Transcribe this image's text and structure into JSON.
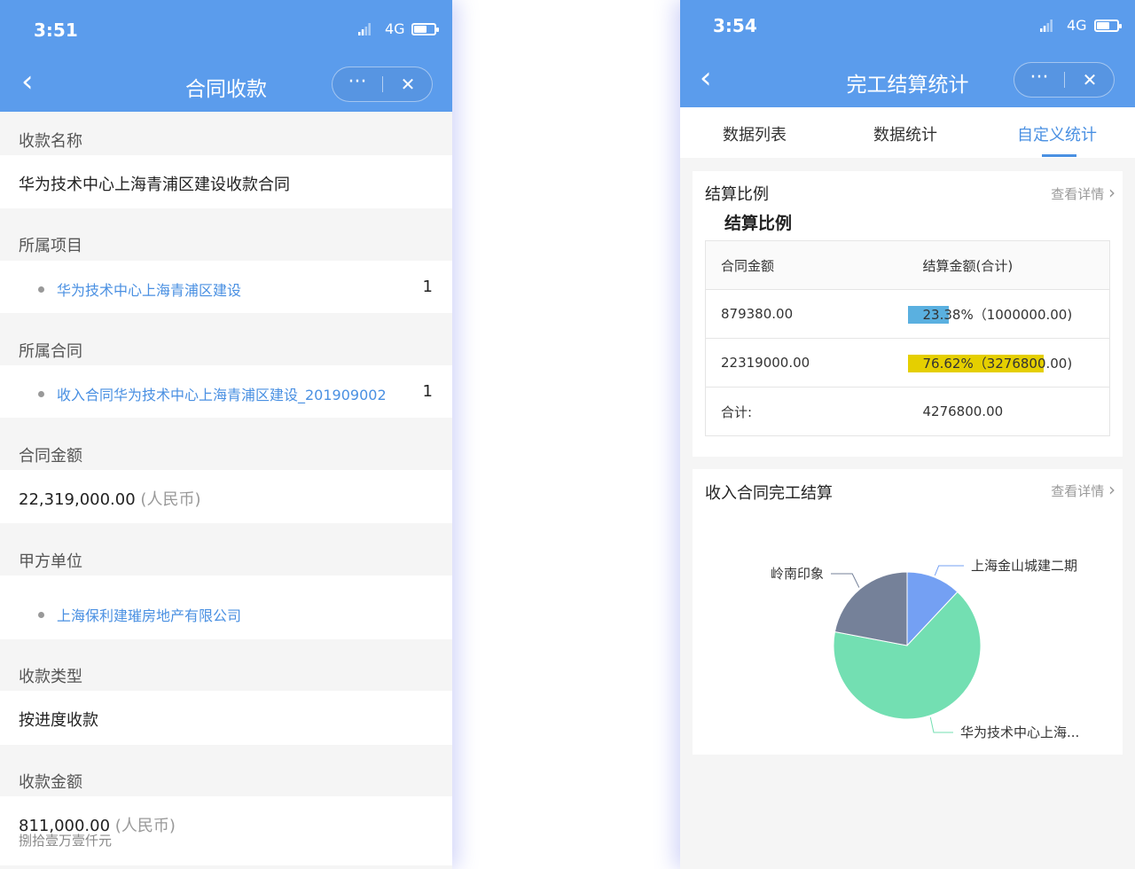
{
  "left": {
    "status": {
      "time": "3:51",
      "network": "4G"
    },
    "nav": {
      "title": "合同收款",
      "back": "‹",
      "more": "···",
      "close": "✕"
    },
    "fields": [
      {
        "label": "收款名称",
        "value": "华为技术中心上海青浦区建设收款合同"
      },
      {
        "label": "所属项目",
        "link": "华为技术中心上海青浦区建设",
        "count": "1"
      },
      {
        "label": "所属合同",
        "link": "收入合同华为技术中心上海青浦区建设_201909002",
        "count": "1"
      },
      {
        "label": "合同金额",
        "value": "22,319,000.00",
        "unit": "(人民币)"
      },
      {
        "label": "甲方单位",
        "link": "上海保利建璀房地产有限公司"
      },
      {
        "label": "收款类型",
        "value": "按进度收款"
      },
      {
        "label": "收款金额",
        "value": "811,000.00",
        "unit": "(人民币)",
        "sub": "捌拾壹万壹仟元"
      }
    ]
  },
  "right": {
    "status": {
      "time": "3:54",
      "network": "4G"
    },
    "nav": {
      "title": "完工结算统计",
      "back": "‹",
      "more": "···",
      "close": "✕"
    },
    "tabs": [
      {
        "label": "数据列表",
        "active": false
      },
      {
        "label": "数据统计",
        "active": false
      },
      {
        "label": "自定义统计",
        "active": true
      }
    ],
    "card1": {
      "title": "结算比例",
      "link": "查看详情",
      "chevron": "›",
      "subtitle": "结算比例",
      "headers": [
        "合同金额",
        "结算金额(合计)"
      ],
      "rows": [
        {
          "amount": "879380.00",
          "ratio": "23.38%（1000000.00)",
          "percent": 23.38,
          "color": "#5ab0e0"
        },
        {
          "amount": "22319000.00",
          "ratio": "76.62%（3276800.00)",
          "percent": 76.62,
          "color": "#e5cf00"
        }
      ],
      "total": {
        "label": "合计:",
        "value": "4276800.00"
      }
    },
    "card2": {
      "title": "收入合同完工结算",
      "link": "查看详情",
      "chevron": "›"
    },
    "chart_data": {
      "type": "pie",
      "labels": [
        "上海金山城建二期",
        "华为技术中心上海...",
        "岭南印象"
      ],
      "values": [
        12,
        66,
        22
      ],
      "colors": [
        "#74a0f3",
        "#73dfb2",
        "#758199"
      ],
      "legend": "none"
    }
  }
}
